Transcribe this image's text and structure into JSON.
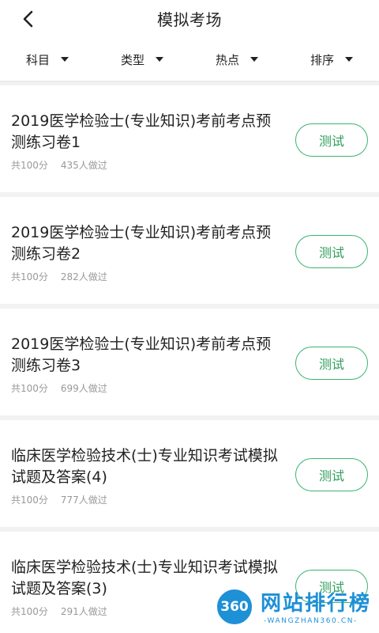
{
  "header": {
    "title": "模拟考场",
    "back_icon": "chevron-left-icon"
  },
  "filters": [
    {
      "label": "科目"
    },
    {
      "label": "类型"
    },
    {
      "label": "热点"
    },
    {
      "label": "排序"
    }
  ],
  "exams": [
    {
      "title": "2019医学检验士(专业知识)考前考点预测练习卷1",
      "score": "共100分",
      "takers": "435人做过",
      "button": "测试"
    },
    {
      "title": "2019医学检验士(专业知识)考前考点预测练习卷2",
      "score": "共100分",
      "takers": "282人做过",
      "button": "测试"
    },
    {
      "title": "2019医学检验士(专业知识)考前考点预测练习卷3",
      "score": "共100分",
      "takers": "699人做过",
      "button": "测试"
    },
    {
      "title": "临床医学检验技术(士)专业知识考试模拟试题及答案(4)",
      "score": "共100分",
      "takers": "777人做过",
      "button": "测试"
    },
    {
      "title": "临床医学检验技术(士)专业知识考试模拟试题及答案(3)",
      "score": "共100分",
      "takers": "291人做过",
      "button": "测试"
    }
  ],
  "watermark": {
    "logo_text": "360",
    "cn": "网站排行榜",
    "en": "-WANGZHAN360.CN-"
  },
  "colors": {
    "accent_green": "#3cb371",
    "watermark_blue": "#1e90d6"
  }
}
